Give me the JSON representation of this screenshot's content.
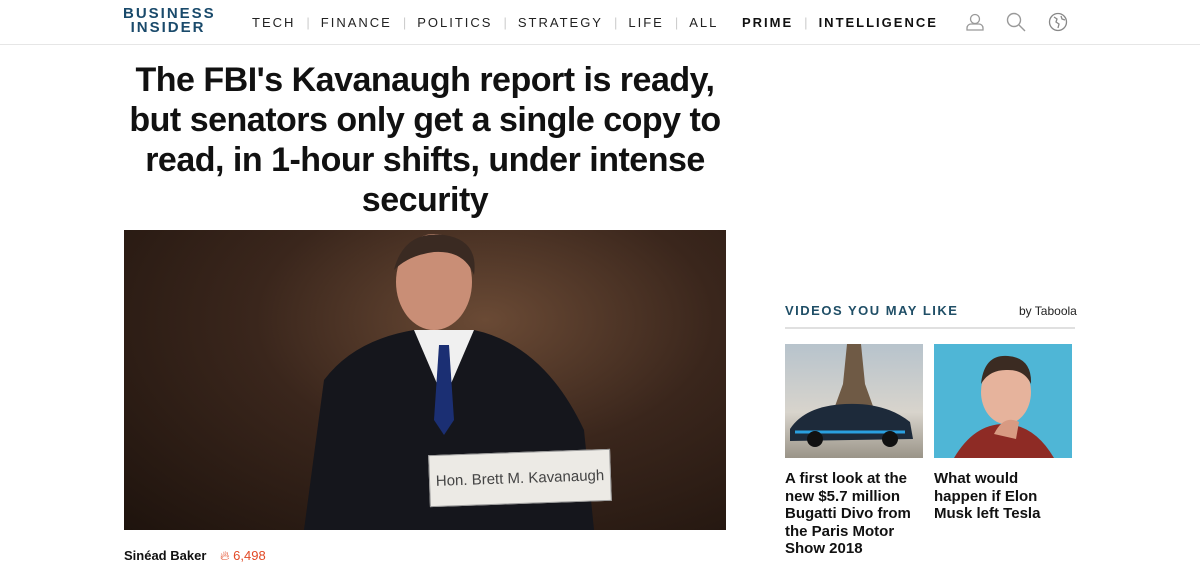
{
  "header": {
    "logo": [
      "BUSINESS",
      "INSIDER"
    ],
    "nav": [
      "TECH",
      "FINANCE",
      "POLITICS",
      "STRATEGY",
      "LIFE",
      "ALL"
    ],
    "nav_right": [
      "PRIME",
      "INTELLIGENCE"
    ],
    "icons": [
      "user-icon",
      "search-icon",
      "globe-icon"
    ]
  },
  "article": {
    "headline": "The FBI's Kavanaugh report is ready, but senators only get a single copy to read, in 1-hour shifts, under intense security",
    "photo_placard": "Hon. Brett M. Kavanaugh",
    "author": "Sinéad Baker",
    "views": "6,498"
  },
  "videos": {
    "title": "VIDEOS YOU MAY LIKE",
    "attribution": "by Taboola",
    "items": [
      {
        "caption": "A first look at the new $5.7 million Bugatti Divo from the Paris Motor Show 2018"
      },
      {
        "caption": "What would happen if Elon Musk left Tesla"
      }
    ]
  },
  "colors": {
    "brand": "#1a4a6b",
    "views": "#e24a26"
  }
}
